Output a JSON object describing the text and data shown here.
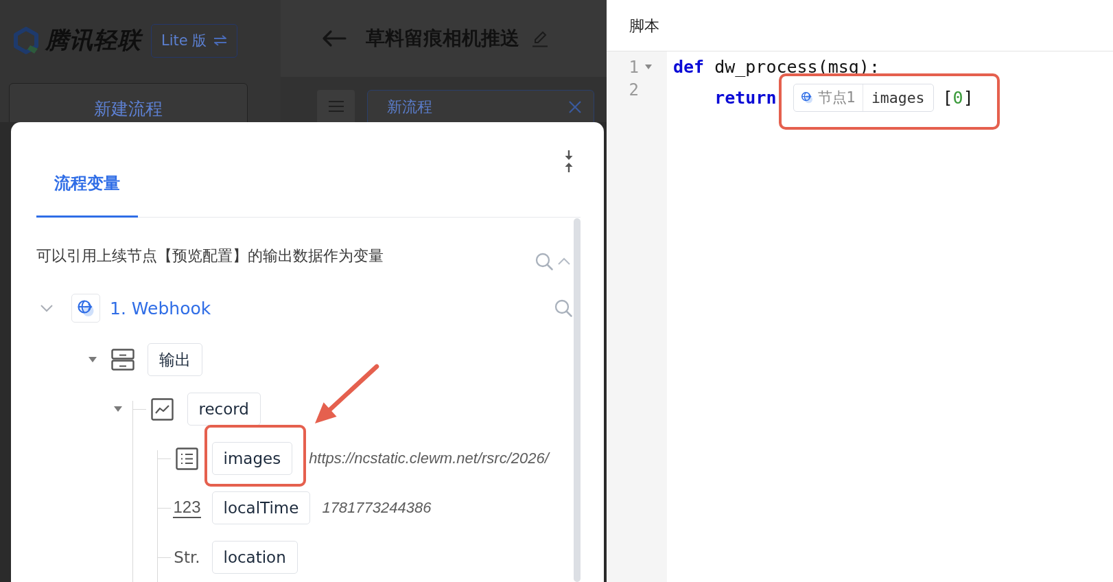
{
  "background_page": {
    "logo": {
      "text": "腾讯轻联"
    },
    "edition_button": {
      "label": "Lite 版"
    },
    "flow_title": "草料留痕相机推送",
    "new_flow_button": {
      "label": "新建流程"
    },
    "flow_tabs": [
      {
        "label": "新流程",
        "selected": true
      }
    ]
  },
  "variables_panel": {
    "tabs": [
      {
        "label": "流程变量",
        "selected": true
      }
    ],
    "description": "可以引用上续节点【预览配置】的输出数据作为变量",
    "tree": [
      {
        "kind": "node",
        "label": "1. Webhook",
        "expanded": true,
        "highlighted": false,
        "children": [
          {
            "kind": "group",
            "label": "输出",
            "expanded": true,
            "highlighted": false,
            "children": [
              {
                "kind": "object",
                "label": "record",
                "expanded": true,
                "highlighted": false,
                "children": [
                  {
                    "kind": "list",
                    "label": "images",
                    "value": "https://ncstatic.clewm.net/rsrc/2026/",
                    "highlighted": true
                  },
                  {
                    "kind": "number",
                    "type_icon": "123",
                    "label": "localTime",
                    "value": "1781773244386",
                    "highlighted": false
                  },
                  {
                    "kind": "string",
                    "type_icon": "Str.",
                    "label": "location",
                    "highlighted": false
                  }
                ]
              }
            ]
          }
        ]
      }
    ]
  },
  "script_panel": {
    "title": "脚本",
    "lines": [
      {
        "number": "1",
        "foldable": true,
        "indented": false,
        "tokens": [
          {
            "kind": "keyword",
            "text": "def",
            "highlighted": false
          },
          {
            "kind": "plain",
            "text": "dw_process(msg):",
            "highlighted": false
          }
        ]
      },
      {
        "number": "2",
        "foldable": false,
        "indented": true,
        "tokens": [
          {
            "kind": "keyword",
            "text": "return",
            "highlighted": false
          },
          {
            "kind": "reference",
            "node": "节点1",
            "field": "images",
            "highlighted": true
          },
          {
            "kind": "punctuation",
            "text": "[",
            "highlighted": true
          },
          {
            "kind": "number",
            "text": "0",
            "highlighted": true
          },
          {
            "kind": "punctuation",
            "text": "]",
            "highlighted": true
          }
        ]
      }
    ]
  }
}
